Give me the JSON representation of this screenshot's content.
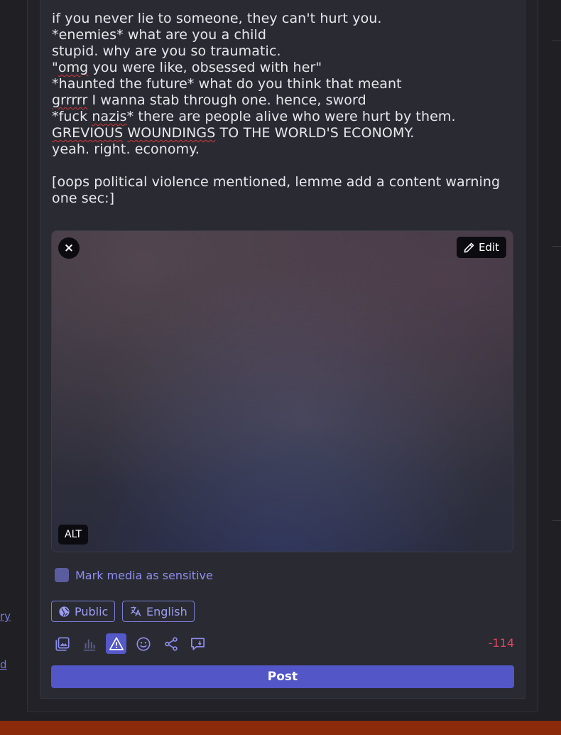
{
  "post_text": {
    "line0": "if you never lie to someone, they can't hurt you.",
    "line1": "*enemies* what are you a child",
    "line2": "stupid. why are you so traumatic.",
    "line3_pre": "\"",
    "line3_spell": "omg",
    "line3_post": " you were like, obsessed with her\"",
    "line4": "*haunted the future* what do you think that meant",
    "line5_spell": "grrrrr",
    "line5_post": " I wanna stab through one. hence, sword",
    "line6_pre": "*fuck ",
    "line6_spell": "nazis",
    "line6_post": "* there are people alive who were hurt by them.",
    "line7_spell1": "GREVIOUS",
    "line7_space": " ",
    "line7_spell2": "WOUNDINGS",
    "line7_post": " TO THE WORLD'S ECONOMY.",
    "line8": "yeah. right. economy.",
    "line10": "[oops political violence mentioned, lemme add a content warning one sec:]"
  },
  "media": {
    "edit_label": "Edit",
    "alt_label": "ALT",
    "close_icon": "×"
  },
  "sensitive": {
    "label": "Mark media as sensitive",
    "checked": false
  },
  "visibility": {
    "label": "Public"
  },
  "language": {
    "label": "English"
  },
  "toolbar": {
    "icons": [
      "media-icon",
      "poll-icon",
      "content-warning-icon",
      "emoji-icon",
      "share-icon",
      "quote-icon"
    ],
    "active": "content-warning-icon"
  },
  "character_counter": "-114",
  "post_button": "Post",
  "left_links": [
    "ry",
    "d"
  ],
  "colors": {
    "accent": "#5256c7",
    "counter_error": "#e0455c",
    "bottom_bar": "#8b2a0a"
  }
}
